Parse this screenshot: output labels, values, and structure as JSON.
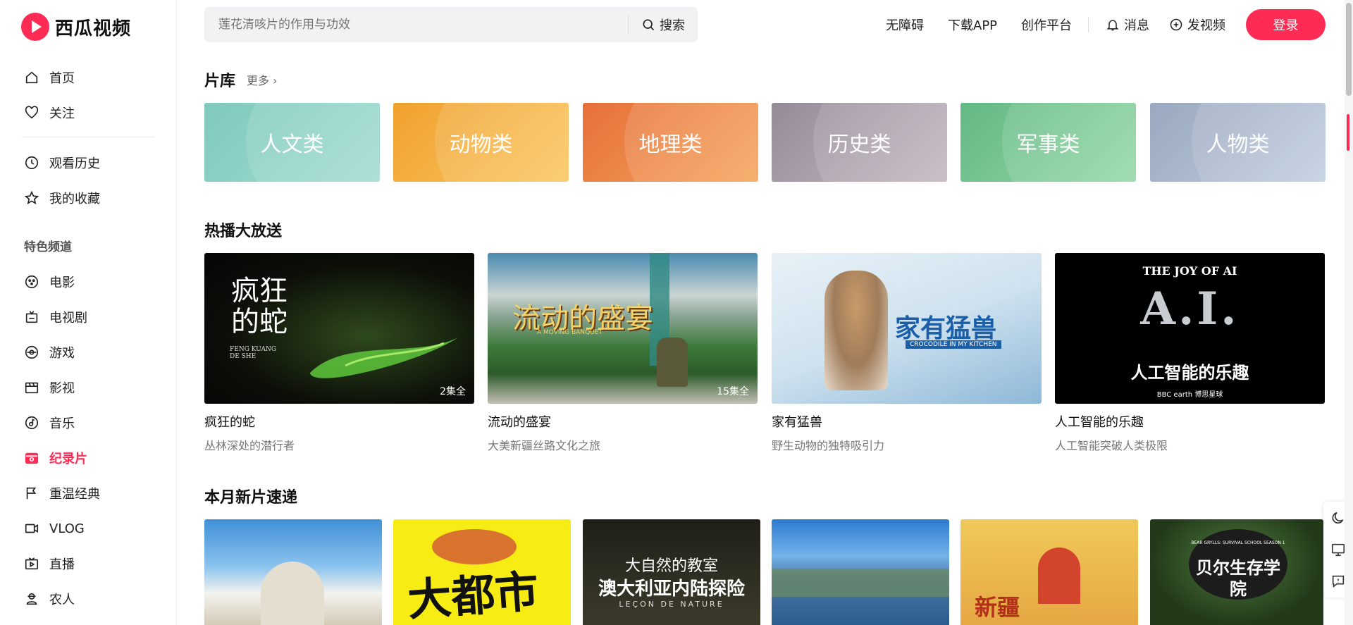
{
  "app": {
    "logo_text": "西瓜视频"
  },
  "sidebar": {
    "items": [
      {
        "label": "首页",
        "icon": "home-icon"
      },
      {
        "label": "关注",
        "icon": "heart-icon"
      },
      {
        "label": "观看历史",
        "icon": "clock-icon"
      },
      {
        "label": "我的收藏",
        "icon": "star-icon"
      }
    ],
    "section_label": "特色频道",
    "channels": [
      {
        "label": "电影",
        "icon": "film-reel-icon"
      },
      {
        "label": "电视剧",
        "icon": "tv-icon"
      },
      {
        "label": "游戏",
        "icon": "gamepad-icon"
      },
      {
        "label": "影视",
        "icon": "clapper-icon"
      },
      {
        "label": "音乐",
        "icon": "music-icon"
      },
      {
        "label": "纪录片",
        "icon": "documentary-icon",
        "active": true
      },
      {
        "label": "重温经典",
        "icon": "flag-icon"
      },
      {
        "label": "VLOG",
        "icon": "camera-icon"
      },
      {
        "label": "直播",
        "icon": "live-icon"
      },
      {
        "label": "农人",
        "icon": "farmer-icon"
      }
    ]
  },
  "header": {
    "search_placeholder": "莲花清咳片的作用与功效",
    "search_button": "搜索",
    "links": {
      "accessibility": "无障碍",
      "download": "下载APP",
      "creator": "创作平台"
    },
    "messages": "消息",
    "upload": "发视频",
    "login": "登录"
  },
  "library": {
    "title": "片库",
    "more": "更多",
    "categories": [
      {
        "label": "人文类",
        "color_from": "#8fd1c6",
        "color_to": "#7fcfc4"
      },
      {
        "label": "动物类",
        "color_from": "#f2a23a",
        "color_to": "#f8c25a"
      },
      {
        "label": "地理类",
        "color_from": "#ea7a3c",
        "color_to": "#f4a259"
      },
      {
        "label": "历史类",
        "color_from": "#9a8f9c",
        "color_to": "#bfb3be"
      },
      {
        "label": "军事类",
        "color_from": "#6cc08a",
        "color_to": "#8ad3a0"
      },
      {
        "label": "人物类",
        "color_from": "#a0aec4",
        "color_to": "#bccbdc"
      }
    ]
  },
  "hot": {
    "title": "热播大放送",
    "items": [
      {
        "title": "疯狂的蛇",
        "subtitle": "丛林深处的潜行者",
        "episodes": "2集全",
        "poster_text": "疯狂的蛇",
        "poster_sub": "FENG KUANG DE SHE"
      },
      {
        "title": "流动的盛宴",
        "subtitle": "大美新疆丝路文化之旅",
        "episodes": "15集全",
        "poster_text": "流动的盛宴",
        "poster_sub": "A MOVING BANQUET"
      },
      {
        "title": "家有猛兽",
        "subtitle": "野生动物的独特吸引力",
        "episodes": "",
        "poster_text": "家有猛兽",
        "poster_sub": "CROCODILE IN MY KITCHEN"
      },
      {
        "title": "人工智能的乐趣",
        "subtitle": "人工智能突破人类极限",
        "episodes": "",
        "poster_text": "人工智能的乐趣",
        "poster_sub": "THE JOY OF AI",
        "poster_big": "A.I.",
        "poster_brand": "BBC earth 博思星球"
      }
    ]
  },
  "new_month": {
    "title": "本月新片速递",
    "items": [
      {
        "poster_text": ""
      },
      {
        "poster_text": "大都市"
      },
      {
        "poster_text": "大自然的教室",
        "poster_text2": "澳大利亚内陆探险",
        "poster_sub": "LEÇON DE NATURE"
      },
      {
        "poster_text": ""
      },
      {
        "poster_text": "新疆"
      },
      {
        "poster_text": "贝尔生存学院",
        "poster_sub": "BEAR GRYLLS: SURVIVAL SCHOOL SEASON 1"
      }
    ]
  },
  "tools": [
    "moon-icon",
    "screen-icon",
    "feedback-icon"
  ]
}
